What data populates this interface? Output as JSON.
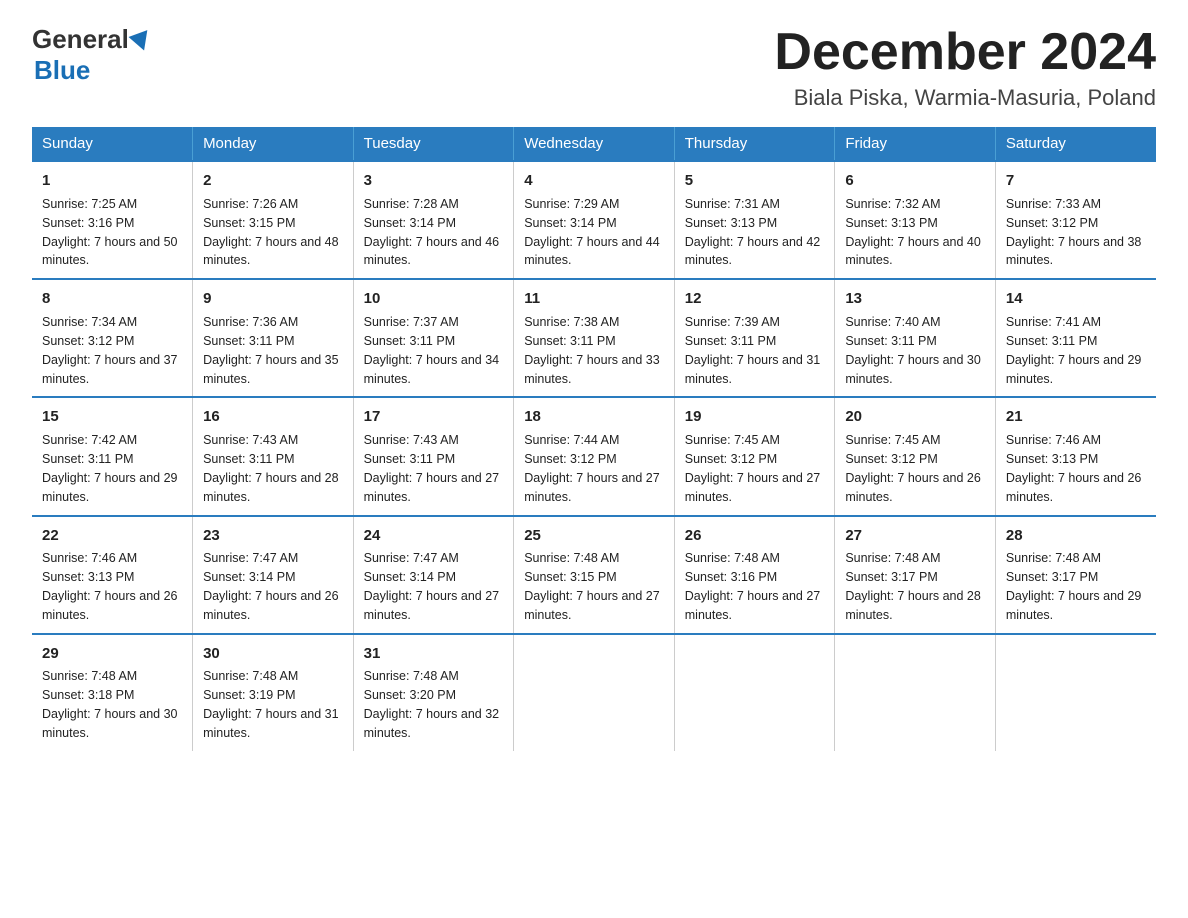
{
  "header": {
    "logo_general": "General",
    "logo_blue": "Blue",
    "month_title": "December 2024",
    "location": "Biala Piska, Warmia-Masuria, Poland"
  },
  "days_of_week": [
    "Sunday",
    "Monday",
    "Tuesday",
    "Wednesday",
    "Thursday",
    "Friday",
    "Saturday"
  ],
  "weeks": [
    [
      {
        "day": "1",
        "sunrise": "7:25 AM",
        "sunset": "3:16 PM",
        "daylight": "7 hours and 50 minutes."
      },
      {
        "day": "2",
        "sunrise": "7:26 AM",
        "sunset": "3:15 PM",
        "daylight": "7 hours and 48 minutes."
      },
      {
        "day": "3",
        "sunrise": "7:28 AM",
        "sunset": "3:14 PM",
        "daylight": "7 hours and 46 minutes."
      },
      {
        "day": "4",
        "sunrise": "7:29 AM",
        "sunset": "3:14 PM",
        "daylight": "7 hours and 44 minutes."
      },
      {
        "day": "5",
        "sunrise": "7:31 AM",
        "sunset": "3:13 PM",
        "daylight": "7 hours and 42 minutes."
      },
      {
        "day": "6",
        "sunrise": "7:32 AM",
        "sunset": "3:13 PM",
        "daylight": "7 hours and 40 minutes."
      },
      {
        "day": "7",
        "sunrise": "7:33 AM",
        "sunset": "3:12 PM",
        "daylight": "7 hours and 38 minutes."
      }
    ],
    [
      {
        "day": "8",
        "sunrise": "7:34 AM",
        "sunset": "3:12 PM",
        "daylight": "7 hours and 37 minutes."
      },
      {
        "day": "9",
        "sunrise": "7:36 AM",
        "sunset": "3:11 PM",
        "daylight": "7 hours and 35 minutes."
      },
      {
        "day": "10",
        "sunrise": "7:37 AM",
        "sunset": "3:11 PM",
        "daylight": "7 hours and 34 minutes."
      },
      {
        "day": "11",
        "sunrise": "7:38 AM",
        "sunset": "3:11 PM",
        "daylight": "7 hours and 33 minutes."
      },
      {
        "day": "12",
        "sunrise": "7:39 AM",
        "sunset": "3:11 PM",
        "daylight": "7 hours and 31 minutes."
      },
      {
        "day": "13",
        "sunrise": "7:40 AM",
        "sunset": "3:11 PM",
        "daylight": "7 hours and 30 minutes."
      },
      {
        "day": "14",
        "sunrise": "7:41 AM",
        "sunset": "3:11 PM",
        "daylight": "7 hours and 29 minutes."
      }
    ],
    [
      {
        "day": "15",
        "sunrise": "7:42 AM",
        "sunset": "3:11 PM",
        "daylight": "7 hours and 29 minutes."
      },
      {
        "day": "16",
        "sunrise": "7:43 AM",
        "sunset": "3:11 PM",
        "daylight": "7 hours and 28 minutes."
      },
      {
        "day": "17",
        "sunrise": "7:43 AM",
        "sunset": "3:11 PM",
        "daylight": "7 hours and 27 minutes."
      },
      {
        "day": "18",
        "sunrise": "7:44 AM",
        "sunset": "3:12 PM",
        "daylight": "7 hours and 27 minutes."
      },
      {
        "day": "19",
        "sunrise": "7:45 AM",
        "sunset": "3:12 PM",
        "daylight": "7 hours and 27 minutes."
      },
      {
        "day": "20",
        "sunrise": "7:45 AM",
        "sunset": "3:12 PM",
        "daylight": "7 hours and 26 minutes."
      },
      {
        "day": "21",
        "sunrise": "7:46 AM",
        "sunset": "3:13 PM",
        "daylight": "7 hours and 26 minutes."
      }
    ],
    [
      {
        "day": "22",
        "sunrise": "7:46 AM",
        "sunset": "3:13 PM",
        "daylight": "7 hours and 26 minutes."
      },
      {
        "day": "23",
        "sunrise": "7:47 AM",
        "sunset": "3:14 PM",
        "daylight": "7 hours and 26 minutes."
      },
      {
        "day": "24",
        "sunrise": "7:47 AM",
        "sunset": "3:14 PM",
        "daylight": "7 hours and 27 minutes."
      },
      {
        "day": "25",
        "sunrise": "7:48 AM",
        "sunset": "3:15 PM",
        "daylight": "7 hours and 27 minutes."
      },
      {
        "day": "26",
        "sunrise": "7:48 AM",
        "sunset": "3:16 PM",
        "daylight": "7 hours and 27 minutes."
      },
      {
        "day": "27",
        "sunrise": "7:48 AM",
        "sunset": "3:17 PM",
        "daylight": "7 hours and 28 minutes."
      },
      {
        "day": "28",
        "sunrise": "7:48 AM",
        "sunset": "3:17 PM",
        "daylight": "7 hours and 29 minutes."
      }
    ],
    [
      {
        "day": "29",
        "sunrise": "7:48 AM",
        "sunset": "3:18 PM",
        "daylight": "7 hours and 30 minutes."
      },
      {
        "day": "30",
        "sunrise": "7:48 AM",
        "sunset": "3:19 PM",
        "daylight": "7 hours and 31 minutes."
      },
      {
        "day": "31",
        "sunrise": "7:48 AM",
        "sunset": "3:20 PM",
        "daylight": "7 hours and 32 minutes."
      },
      null,
      null,
      null,
      null
    ]
  ]
}
